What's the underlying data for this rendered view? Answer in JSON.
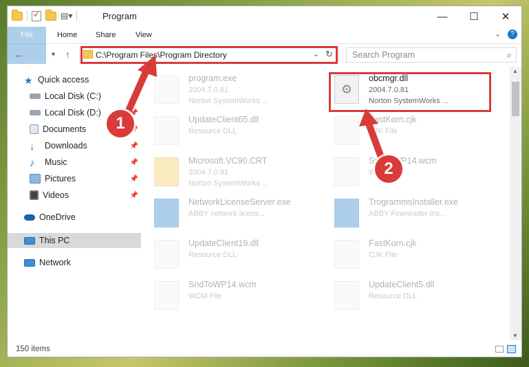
{
  "window": {
    "title": "Program",
    "minimize": "—",
    "maximize": "☐",
    "close": "✕"
  },
  "ribbon": {
    "tabs": [
      "File",
      "Home",
      "Share",
      "View"
    ]
  },
  "address": {
    "path": "C:\\Program Files\\Program Directory",
    "search_placeholder": "Search Program"
  },
  "nav": {
    "items": [
      {
        "label": "Quick access"
      },
      {
        "label": "Local Disk (C:)"
      },
      {
        "label": "Local Disk (D:)"
      },
      {
        "label": "Documents"
      },
      {
        "label": "Downloads"
      },
      {
        "label": "Music"
      },
      {
        "label": "Pictures"
      },
      {
        "label": "Videos"
      },
      {
        "label": "OneDrive"
      },
      {
        "label": "This PC"
      },
      {
        "label": "Network"
      }
    ]
  },
  "files": [
    {
      "name": "program.exe",
      "line2": "2004.7.0.81",
      "line3": "Norton SystemWorks ..."
    },
    {
      "name": "obcmgr.dll",
      "line2": "2004.7.0.81",
      "line3": "Norton SystemWorks ..."
    },
    {
      "name": "UpdateClient65.dll",
      "line2": "Resource DLL",
      "line3": ""
    },
    {
      "name": "FastKorn.cjk",
      "line2": "CJK File",
      "line3": ""
    },
    {
      "name": "Microsoft.VC90.CRT",
      "line2": "2004.7.0.81",
      "line3": "Norton SystemWorks ..."
    },
    {
      "name": "SndToWP14.wcm",
      "line2": "WCM File",
      "line3": ""
    },
    {
      "name": "NetworkLicenseServer.exe",
      "line2": "ABBY network licens...",
      "line3": ""
    },
    {
      "name": "TrogrammsInstaller.exe",
      "line2": "ABBY Finereader Ins...",
      "line3": ""
    },
    {
      "name": "UpdateClient19.dll",
      "line2": "Resource DLL",
      "line3": ""
    },
    {
      "name": "FastKorn.cjk",
      "line2": "CJK File",
      "line3": ""
    },
    {
      "name": "SndToWP14.wcm",
      "line2": "WCM File",
      "line3": ""
    },
    {
      "name": "UpdateClient5.dll",
      "line2": "Resource DLL",
      "line3": ""
    }
  ],
  "annotations": {
    "badge1": "1",
    "badge2": "2"
  },
  "status": {
    "item_count": "150 items"
  },
  "colors": {
    "accent": "#1979ca",
    "highlight": "#d93a3a"
  }
}
